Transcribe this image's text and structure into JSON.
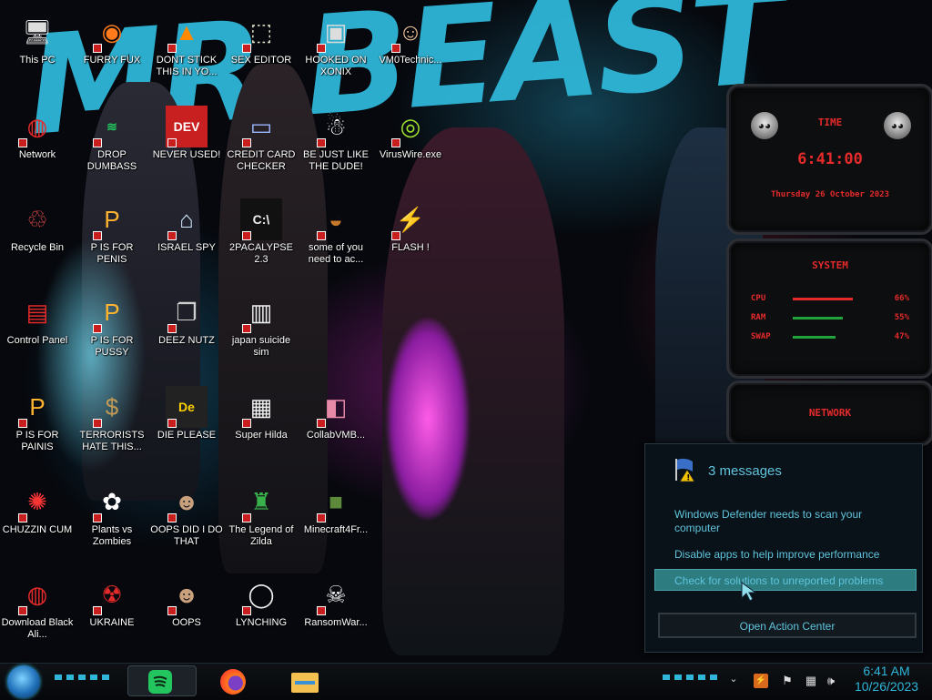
{
  "wallpaper": {
    "title_text": "MR BEAST"
  },
  "desktop_icons": [
    {
      "label": "This PC",
      "glyph": "computer"
    },
    {
      "label": "FURRY FUX",
      "glyph": "firefox"
    },
    {
      "label": "DONT STICK THIS IN YO...",
      "glyph": "vlc"
    },
    {
      "label": "SEX EDITOR",
      "glyph": "hxd"
    },
    {
      "label": "HOOKED ON XONIX",
      "glyph": "xonix"
    },
    {
      "label": "VM0Technic...",
      "glyph": "doctor"
    },
    {
      "label": "Network",
      "glyph": "alienware"
    },
    {
      "label": "DROP DUMBASS",
      "glyph": "spotify"
    },
    {
      "label": "NEVER USED!",
      "glyph": "dev"
    },
    {
      "label": "CREDIT CARD CHECKER",
      "glyph": "credit-card"
    },
    {
      "label": "BE JUST LIKE THE DUDE!",
      "glyph": "santa"
    },
    {
      "label": "VirusWire.exe",
      "glyph": "lime"
    },
    {
      "label": "Recycle Bin",
      "glyph": "recycle"
    },
    {
      "label": "P IS FOR PENIS",
      "glyph": "p-logo"
    },
    {
      "label": "ISRAEL SPY",
      "glyph": "network-card"
    },
    {
      "label": "2PACALYPSE 2.3",
      "glyph": "cmd"
    },
    {
      "label": "some of you need to ac...",
      "glyph": "beaver"
    },
    {
      "label": "FLASH !",
      "glyph": "flash"
    },
    {
      "label": "Control Panel",
      "glyph": "control-panel"
    },
    {
      "label": "P IS FOR PUSSY",
      "glyph": "p-logo"
    },
    {
      "label": "DEEZ NUTZ",
      "glyph": "windows"
    },
    {
      "label": "japan suicide sim",
      "glyph": "file"
    },
    {
      "label": "P IS FOR PAINIS",
      "glyph": "p-logo"
    },
    {
      "label": "TERRORISTS HATE THIS...",
      "glyph": "money-bag"
    },
    {
      "label": "DIE PLEASE",
      "glyph": "de"
    },
    {
      "label": "Super Hilda",
      "glyph": "pixel"
    },
    {
      "label": "CollabVMB...",
      "glyph": "collab"
    },
    {
      "label": "CHUZZIN CUM",
      "glyph": "chuzzle"
    },
    {
      "label": "Plants vs Zombies",
      "glyph": "flower"
    },
    {
      "label": "OOPS DID I DO THAT",
      "glyph": "portrait"
    },
    {
      "label": "The Legend of Zilda",
      "glyph": "zelda"
    },
    {
      "label": "Minecraft4Fr...",
      "glyph": "minecraft"
    },
    {
      "label": "Download Black Ali...",
      "glyph": "alienware"
    },
    {
      "label": "UKRAINE",
      "glyph": "radiation"
    },
    {
      "label": "OOPS",
      "glyph": "portrait"
    },
    {
      "label": "LYNCHING",
      "glyph": "noose"
    },
    {
      "label": "RansomWar...",
      "glyph": "skull"
    }
  ],
  "gadget": {
    "time_title": "TIME",
    "time": "6:41:00",
    "date": "Thursday 26 October 2023",
    "system_title": "SYSTEM",
    "cpu_label": "CPU",
    "cpu_value": "66%",
    "cpu_level": 0.66,
    "ram_label": "RAM",
    "ram_value": "55%",
    "ram_level": 0.55,
    "swap_label": "SWAP",
    "swap_value": "47%",
    "swap_level": 0.47,
    "network_title": "NETWORK"
  },
  "notification": {
    "title": "3 messages",
    "messages": [
      "Windows Defender needs to scan your computer",
      "Disable apps to help improve performance",
      "Check for solutions to unreported problems"
    ],
    "action_label": "Open Action Center"
  },
  "taskbar": {
    "pinned": [
      "spotify-icon",
      "firefox-icon",
      "file-explorer-icon"
    ],
    "clock_time": "6:41 AM",
    "clock_date": "10/26/2023"
  },
  "colors": {
    "accent": "#2fb6d8",
    "gadget_red": "#e52a2a",
    "popup_text": "#5fc4dc"
  }
}
